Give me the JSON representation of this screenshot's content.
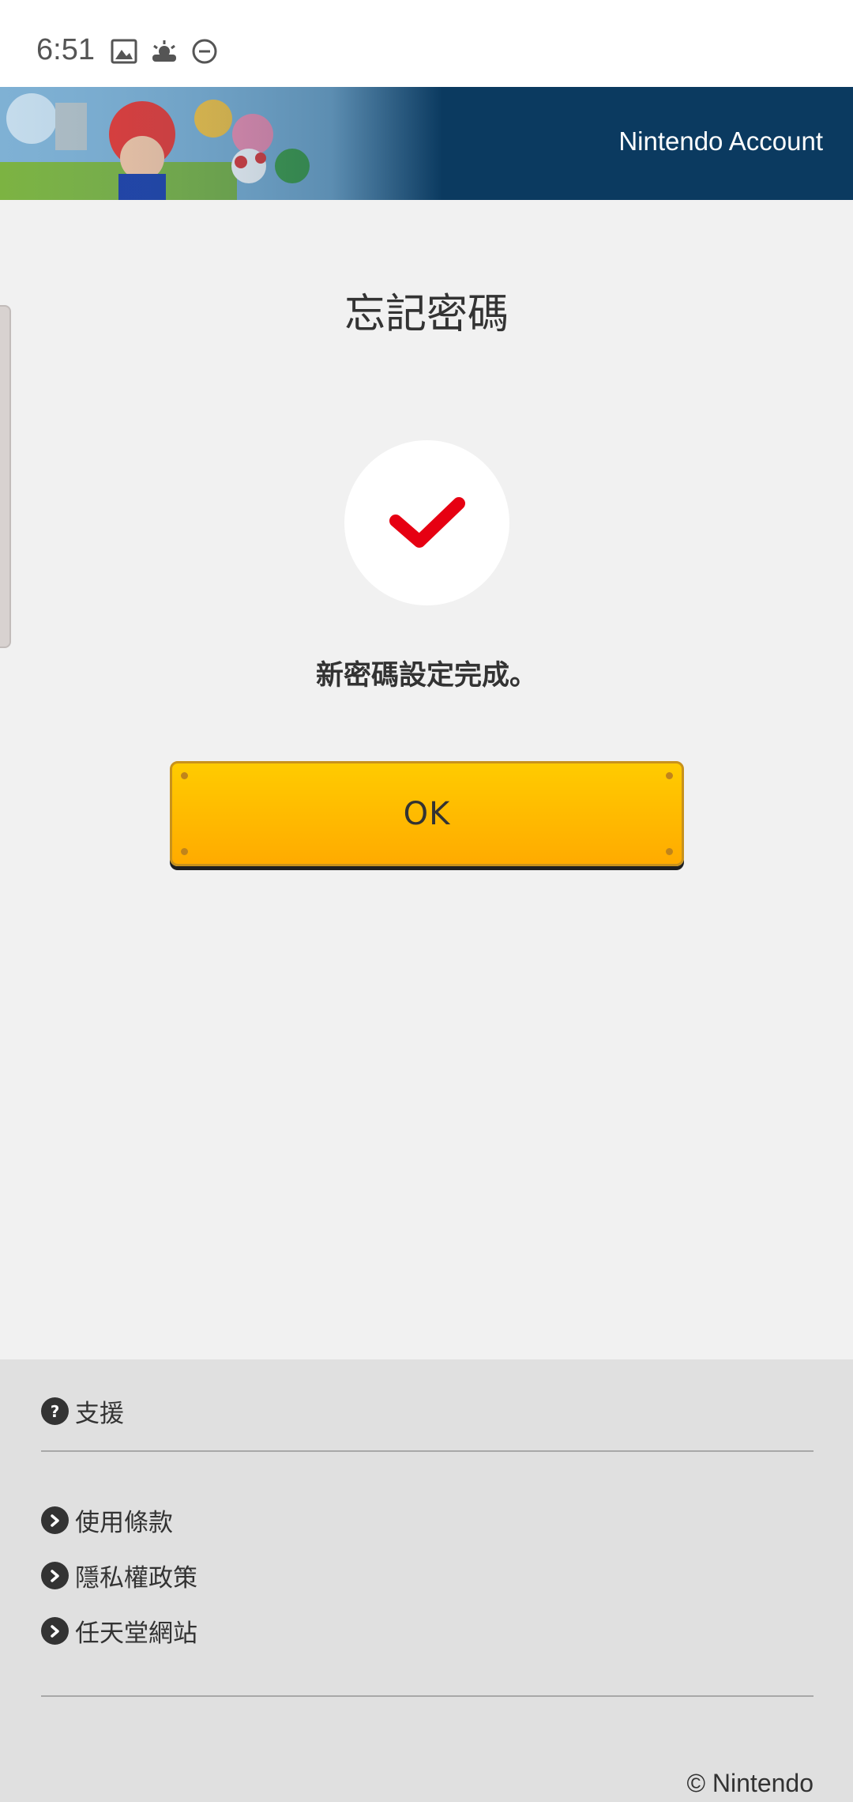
{
  "status_bar": {
    "time": "6:51",
    "icons": [
      "image-icon",
      "weather-icon",
      "do-not-disturb-icon"
    ]
  },
  "header": {
    "title": "Nintendo Account"
  },
  "main": {
    "title": "忘記密碼",
    "success_icon": "checkmark-icon",
    "message": "新密碼設定完成。",
    "ok_button_label": "OK"
  },
  "footer": {
    "support_label": "支援",
    "links": [
      {
        "label": "使用條款"
      },
      {
        "label": "隱私權政策"
      },
      {
        "label": "任天堂網站"
      }
    ],
    "copyright": "© Nintendo"
  },
  "colors": {
    "header_bg": "#0b3a60",
    "page_bg": "#f1f1f1",
    "footer_bg": "#e0e0e0",
    "button_top": "#ffcb00",
    "button_bottom": "#ffab00",
    "check_red": "#e60012"
  }
}
